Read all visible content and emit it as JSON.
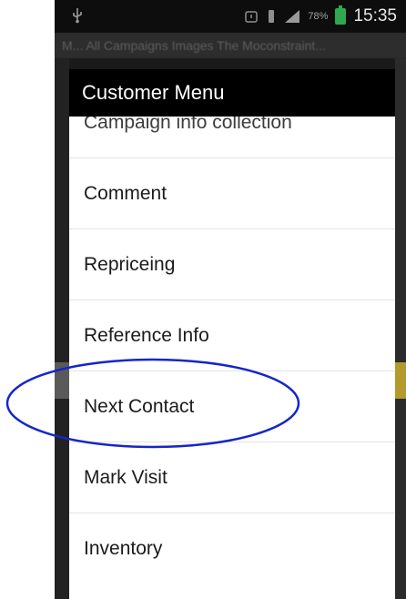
{
  "status_bar": {
    "time": "15:35",
    "battery_percent": "78%",
    "icons": [
      "usb-icon",
      "alarm-icon",
      "vibrate-icon",
      "signal-icon",
      "battery-icon"
    ]
  },
  "background": {
    "title_text": "M... All Campaigns Images The Moconstraint..."
  },
  "dialog": {
    "title": "Customer Menu",
    "items": [
      {
        "label": "Campaign info collection"
      },
      {
        "label": "Comment"
      },
      {
        "label": "Repriceing"
      },
      {
        "label": "Reference Info"
      },
      {
        "label": "Next Contact"
      },
      {
        "label": "Mark Visit"
      },
      {
        "label": "Inventory"
      }
    ]
  },
  "annotation": {
    "color": "#1526c8",
    "target": "Next Contact"
  }
}
